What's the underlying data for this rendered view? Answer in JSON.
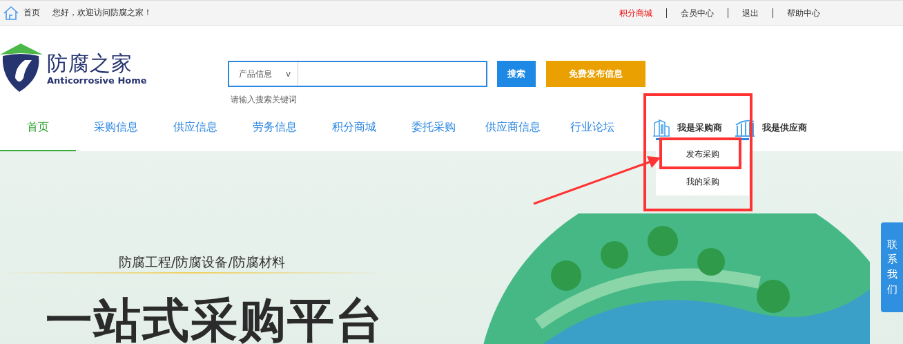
{
  "top_bar": {
    "home": "首页",
    "greeting": "您好，欢迎访问防腐之家！",
    "links": [
      {
        "label": "积分商城",
        "highlighted": true
      },
      {
        "label": "会员中心",
        "highlighted": false
      },
      {
        "label": "退出",
        "highlighted": false
      },
      {
        "label": "帮助中心",
        "highlighted": false
      }
    ]
  },
  "logo": {
    "name": "防腐之家",
    "subtitle": "Anticorrosive Home"
  },
  "search": {
    "category": "产品信息",
    "caret": "v",
    "hint": "请输入搜索关键词",
    "button": "搜索"
  },
  "publish_button": "免费发布信息",
  "nav": [
    {
      "label": "首页",
      "selected": true
    },
    {
      "label": "采购信息",
      "selected": false
    },
    {
      "label": "供应信息",
      "selected": false
    },
    {
      "label": "劳务信息",
      "selected": false
    },
    {
      "label": "积分商城",
      "selected": false
    },
    {
      "label": "委托采购",
      "selected": false
    },
    {
      "label": "供应商信息",
      "selected": false
    },
    {
      "label": "行业论坛",
      "selected": false
    }
  ],
  "roles": [
    {
      "label": "我是采购商",
      "kind": "buyer"
    },
    {
      "label": "我是供应商",
      "kind": "supplier"
    }
  ],
  "dropdown": [
    "发布采购",
    "我的采购"
  ],
  "hero": {
    "tagline": "防腐工程/防腐设备/防腐材料",
    "title": "一站式采购平台"
  },
  "contact_tab": "联系我们"
}
